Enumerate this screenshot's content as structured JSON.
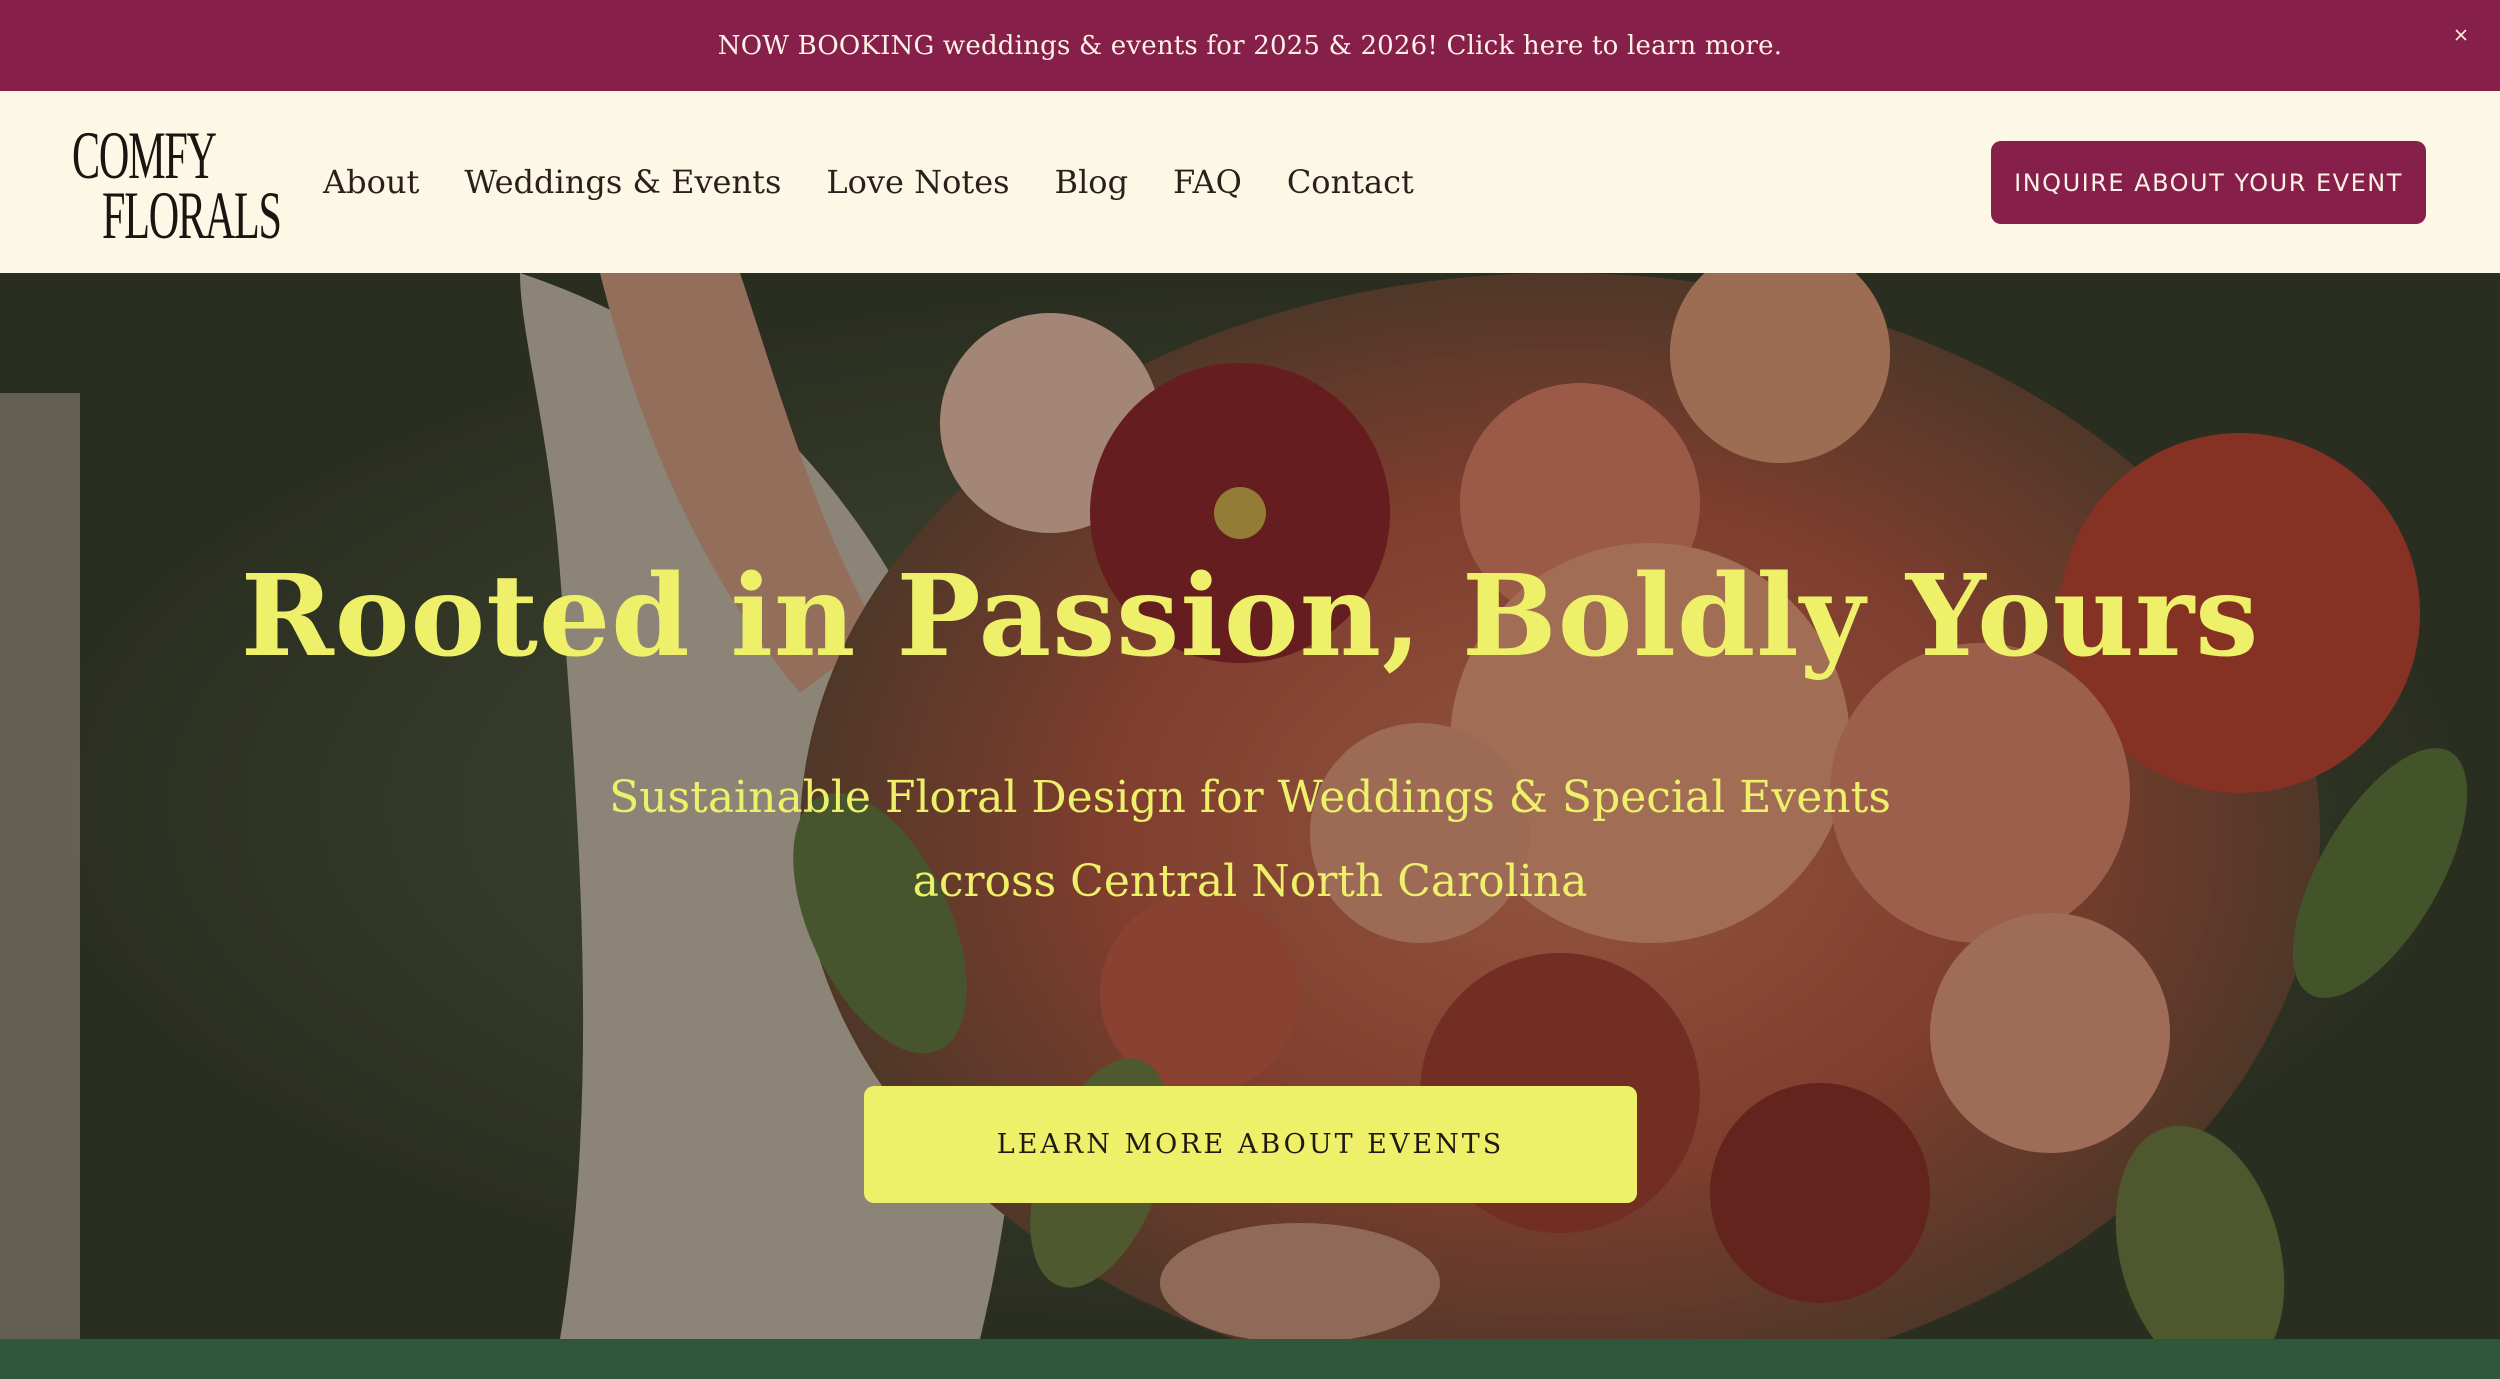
{
  "announcement": {
    "text": "NOW BOOKING weddings & events for 2025 & 2026! Click here to learn more.",
    "close_icon": "close-icon"
  },
  "header": {
    "logo": {
      "line1": "COMFY",
      "line2": "FLORALS"
    },
    "nav": [
      {
        "label": "About"
      },
      {
        "label": "Weddings & Events"
      },
      {
        "label": "Love Notes"
      },
      {
        "label": "Blog"
      },
      {
        "label": "FAQ"
      },
      {
        "label": "Contact"
      }
    ],
    "cta_label": "INQUIRE ABOUT YOUR EVENT"
  },
  "hero": {
    "title": "Rooted in Passion, Boldly Yours",
    "subtitle_line1": "Sustainable Floral Design for Weddings & Special Events",
    "subtitle_line2": "across Central North Carolina",
    "cta_label": "LEARN MORE ABOUT EVENTS",
    "image_subject": "bride-holding-dahlia-bouquet-photo"
  },
  "colors": {
    "brand_burgundy": "#86204a",
    "cream": "#fdf7e6",
    "accent_yellow": "#eef06a",
    "forest_green": "#30573a"
  }
}
